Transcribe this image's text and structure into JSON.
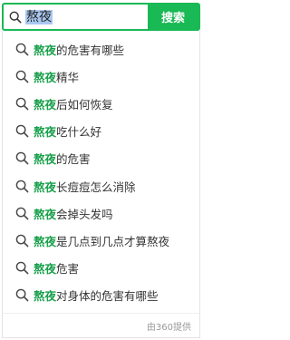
{
  "search": {
    "query": "熬夜",
    "button_label": "搜索"
  },
  "suggestions": [
    {
      "keyword": "熬夜",
      "suffix": "的危害有哪些"
    },
    {
      "keyword": "熬夜",
      "suffix": "精华"
    },
    {
      "keyword": "熬夜",
      "suffix": "后如何恢复"
    },
    {
      "keyword": "熬夜",
      "suffix": "吃什么好"
    },
    {
      "keyword": "熬夜",
      "suffix": "的危害"
    },
    {
      "keyword": "熬夜",
      "suffix": "长痘痘怎么消除"
    },
    {
      "keyword": "熬夜",
      "suffix": "会掉头发吗"
    },
    {
      "keyword": "熬夜",
      "suffix": "是几点到几点才算熬夜"
    },
    {
      "keyword": "熬夜",
      "suffix": "危害"
    },
    {
      "keyword": "熬夜",
      "suffix": "对身体的危害有哪些"
    }
  ],
  "footer": {
    "provider_text": "由360提供"
  },
  "colors": {
    "accent": "#19b955",
    "keyword": "#19a04b",
    "selection": "#a9c8f0"
  }
}
